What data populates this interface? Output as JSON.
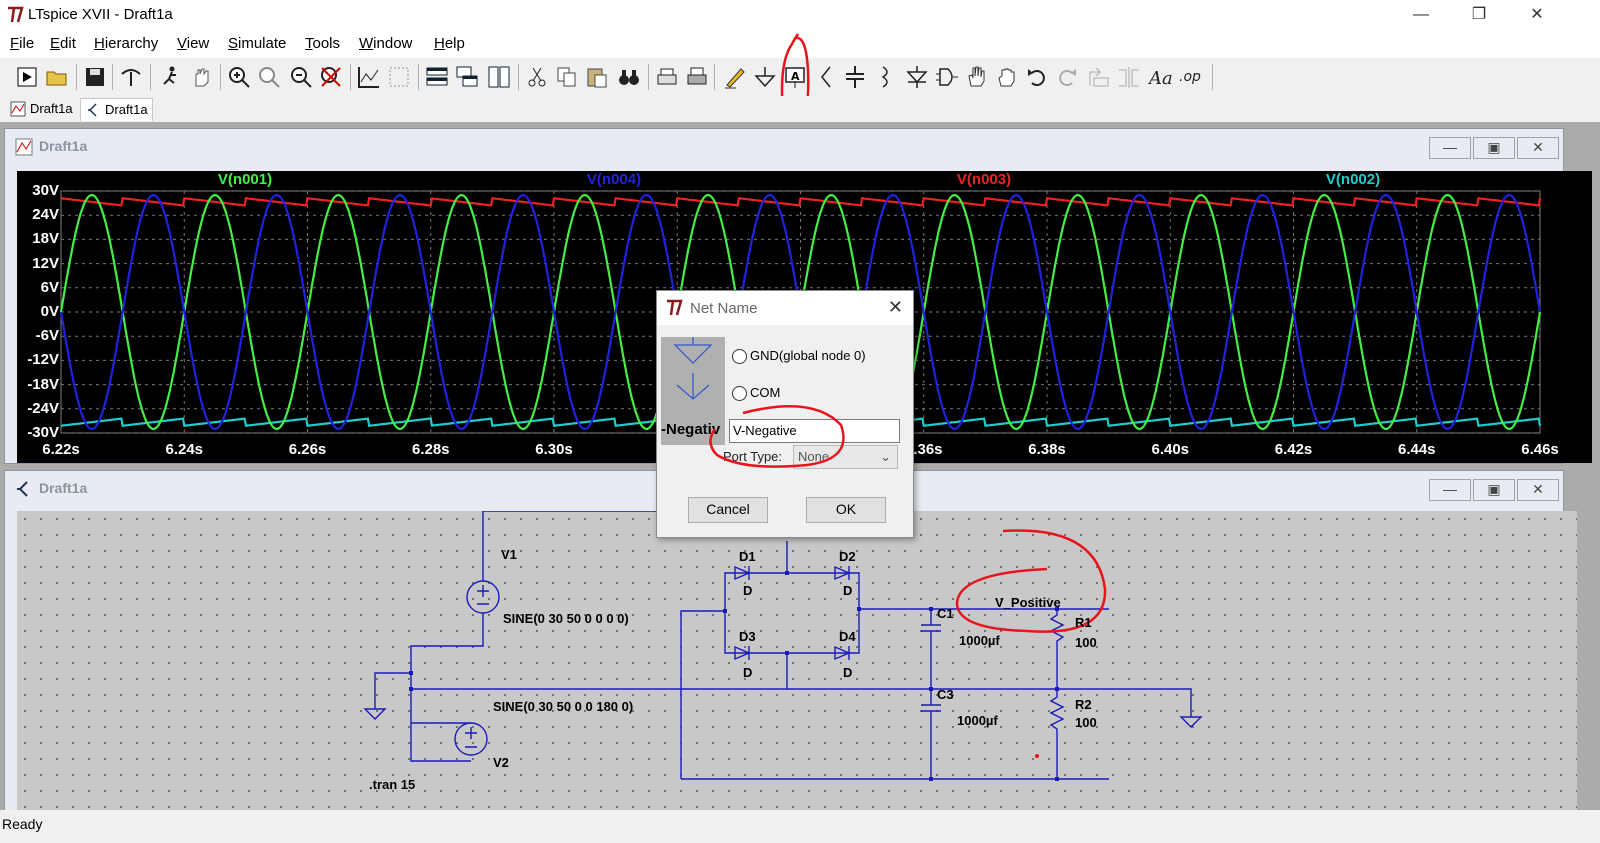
{
  "window": {
    "title": "LTspice XVII - Draft1a",
    "min": "—",
    "max": "❐",
    "close": "✕"
  },
  "menu": [
    "File",
    "Edit",
    "Hierarchy",
    "View",
    "Simulate",
    "Tools",
    "Window",
    "Help"
  ],
  "tabs": [
    {
      "label": "Draft1a",
      "icon": "waveform-icon"
    },
    {
      "label": "Draft1a",
      "icon": "schematic-icon"
    }
  ],
  "waveform_window": {
    "title": "Draft1a",
    "traces": [
      {
        "name": "V(n001)",
        "color": "#44ee44"
      },
      {
        "name": "V(n004)",
        "color": "#2222dd"
      },
      {
        "name": "V(n003)",
        "color": "#ee2222"
      },
      {
        "name": "V(n002)",
        "color": "#22cccc"
      }
    ],
    "yticks": [
      "30V",
      "24V",
      "18V",
      "12V",
      "6V",
      "0V",
      "-6V",
      "-12V",
      "-18V",
      "-24V",
      "-30V"
    ],
    "xticks": [
      "6.22s",
      "6.24s",
      "6.26s",
      "6.28s",
      "6.30s",
      "6.36s",
      "6.38s",
      "6.40s",
      "6.42s",
      "6.44s",
      "6.46s"
    ]
  },
  "schematic_window": {
    "title": "Draft1a",
    "labels": {
      "v1": "V1",
      "v1_value": "SINE(0 30 50 0 0 0 0)",
      "v2": "V2",
      "v2_value": "SINE(0 30 50 0 0 180 0)",
      "d1": "D1",
      "d2": "D2",
      "d3": "D3",
      "d4": "D4",
      "d": "D",
      "c1": "C1",
      "c1_value": "1000µf",
      "c3": "C3",
      "c3_value": "1000µf",
      "r1": "R1",
      "r1_value": "100",
      "r2": "R2",
      "r2_value": "100",
      "net": "V_Positive",
      "directive": ".tran 15"
    }
  },
  "dialog": {
    "title": "Net Name",
    "option_gnd": "GND(global node 0)",
    "option_com": "COM",
    "preview_text": "-Negativ",
    "name_value": "V-Negative",
    "port_type_label": "Port Type:",
    "port_type_value": "None",
    "cancel": "Cancel",
    "ok": "OK"
  },
  "status": "Ready",
  "colors": {
    "annotation": "#e8141c"
  }
}
